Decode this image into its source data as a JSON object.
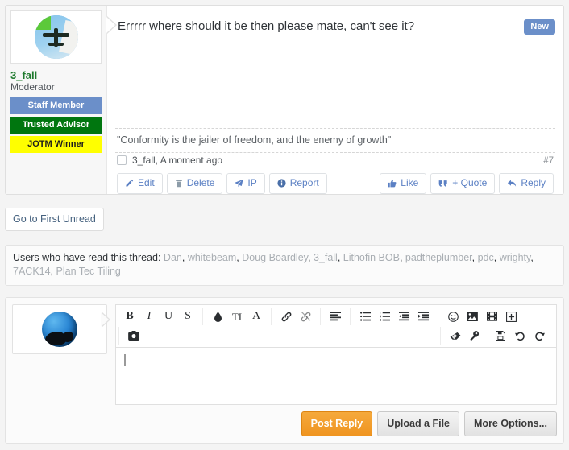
{
  "post": {
    "title": "Errrrr where should it be then please mate, can't see it?",
    "new_badge": "New",
    "post_number": "#7",
    "author": "3_fall",
    "author_title": "Moderator",
    "banners": [
      {
        "label": "Staff Member",
        "color": "#6b8fc9"
      },
      {
        "label": "Trusted Advisor",
        "color": "#00760f"
      },
      {
        "label": "JOTM Winner",
        "color": "#ffff00"
      }
    ],
    "signature": "\"Conformity is the jailer of freedom, and the enemy of growth\"",
    "meta": "3_fall, A moment ago",
    "left_actions": [
      {
        "label": "Edit",
        "icon": "pencil-icon"
      },
      {
        "label": "Delete",
        "icon": "trash-icon"
      },
      {
        "label": "IP",
        "icon": "paper-plane-icon"
      },
      {
        "label": "Report",
        "icon": "info-circle-icon"
      }
    ],
    "right_actions": [
      {
        "label": "Like",
        "icon": "thumbs-up-icon"
      },
      {
        "label": "+ Quote",
        "icon": "quote-icon"
      },
      {
        "label": "Reply",
        "icon": "reply-arrow-icon"
      }
    ]
  },
  "unread": {
    "label": "Go to First Unread"
  },
  "readers": {
    "label": "Users who have read this thread:",
    "names": [
      "Dan",
      "whitebeam",
      "Doug Boardley",
      "3_fall",
      "Lithofin BOB",
      "padtheplumber",
      "pdc",
      "wrighty",
      "7ACK14",
      "Plan Tec Tiling"
    ]
  },
  "editor": {
    "content": "",
    "placeholder": "",
    "toolbar_groups": [
      {
        "name": "text-format",
        "items": [
          "bold-icon",
          "italic-icon",
          "underline-icon",
          "strikethrough-icon"
        ]
      },
      {
        "name": "color-font",
        "items": [
          "text-color-icon",
          "font-size-icon",
          "font-family-icon"
        ]
      },
      {
        "name": "link",
        "items": [
          "link-icon",
          "unlink-icon"
        ]
      },
      {
        "name": "align",
        "items": [
          "align-left-icon"
        ]
      },
      {
        "name": "lists",
        "items": [
          "bullet-list-icon",
          "numbered-list-icon",
          "outdent-icon",
          "indent-icon"
        ]
      },
      {
        "name": "insert",
        "items": [
          "smiley-icon",
          "image-icon",
          "media-icon",
          "insert-icon"
        ]
      },
      {
        "name": "camera",
        "items": [
          "camera-icon"
        ]
      },
      {
        "name": "tools",
        "items": [
          "eraser-icon",
          "wrench-icon"
        ]
      },
      {
        "name": "history",
        "items": [
          "draft-save-icon",
          "undo-icon",
          "redo-icon"
        ]
      }
    ],
    "buttons": [
      {
        "label": "Post Reply",
        "style": "primary"
      },
      {
        "label": "Upload a File",
        "style": "default"
      },
      {
        "label": "More Options...",
        "style": "default"
      }
    ]
  },
  "colors": {
    "accent_blue": "#6b8fc9",
    "link_blue": "#5b80c4",
    "green": "#00760f",
    "yellow": "#ffff00",
    "orange": "#ef9420",
    "username_green": "#1f7a2e"
  }
}
